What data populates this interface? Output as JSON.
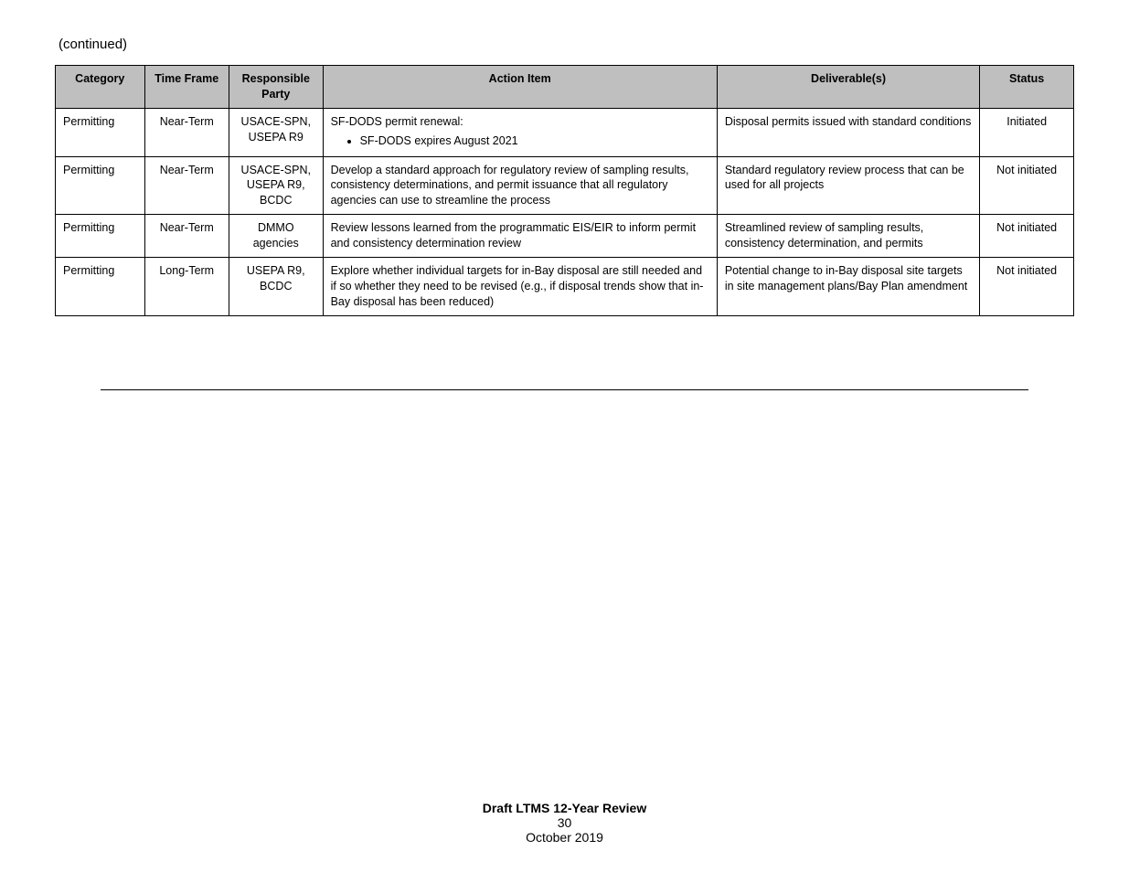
{
  "continued_label": "(continued)",
  "headers": [
    "Category",
    "Time Frame",
    "Responsible Party",
    "Action Item",
    "Deliverable(s)",
    "Status"
  ],
  "rows": [
    {
      "category": "Permitting",
      "time_frame": "Near-Term",
      "responsible": "USACE-SPN, USEPA R9",
      "action_intro": "SF-DODS permit renewal:",
      "action_bullets": [
        "SF-DODS expires August 2021"
      ],
      "deliverable": "Disposal permits issued with standard conditions",
      "status": "Initiated"
    },
    {
      "category": "Permitting",
      "time_frame": "Near-Term",
      "responsible": "USACE-SPN, USEPA R9, BCDC",
      "action_intro": "Develop a standard approach for regulatory review of sampling results, consistency determinations, and permit issuance that all regulatory agencies can use to streamline the process",
      "action_bullets": [],
      "deliverable": "Standard regulatory review process that can be used for all projects",
      "status": "Not initiated"
    },
    {
      "category": "Permitting",
      "time_frame": "Near-Term",
      "responsible": "DMMO agencies",
      "action_intro": "Review lessons learned from the programmatic EIS/EIR to inform permit and consistency determination review",
      "action_bullets": [],
      "deliverable": "Streamlined review of sampling results, consistency determination, and permits",
      "status": "Not initiated"
    },
    {
      "category": "Permitting",
      "time_frame": "Long-Term",
      "responsible": "USEPA R9, BCDC",
      "action_intro": "Explore whether individual targets for in-Bay disposal are still needed and if so whether they need to be revised (e.g., if disposal trends show that in-Bay disposal has been reduced)",
      "action_bullets": [],
      "deliverable": "Potential change to in-Bay disposal site targets in site management plans/Bay Plan amendment",
      "status": "Not initiated"
    }
  ],
  "footer": {
    "title": "Draft LTMS 12-Year Review",
    "page": "30",
    "date": "October 2019"
  }
}
